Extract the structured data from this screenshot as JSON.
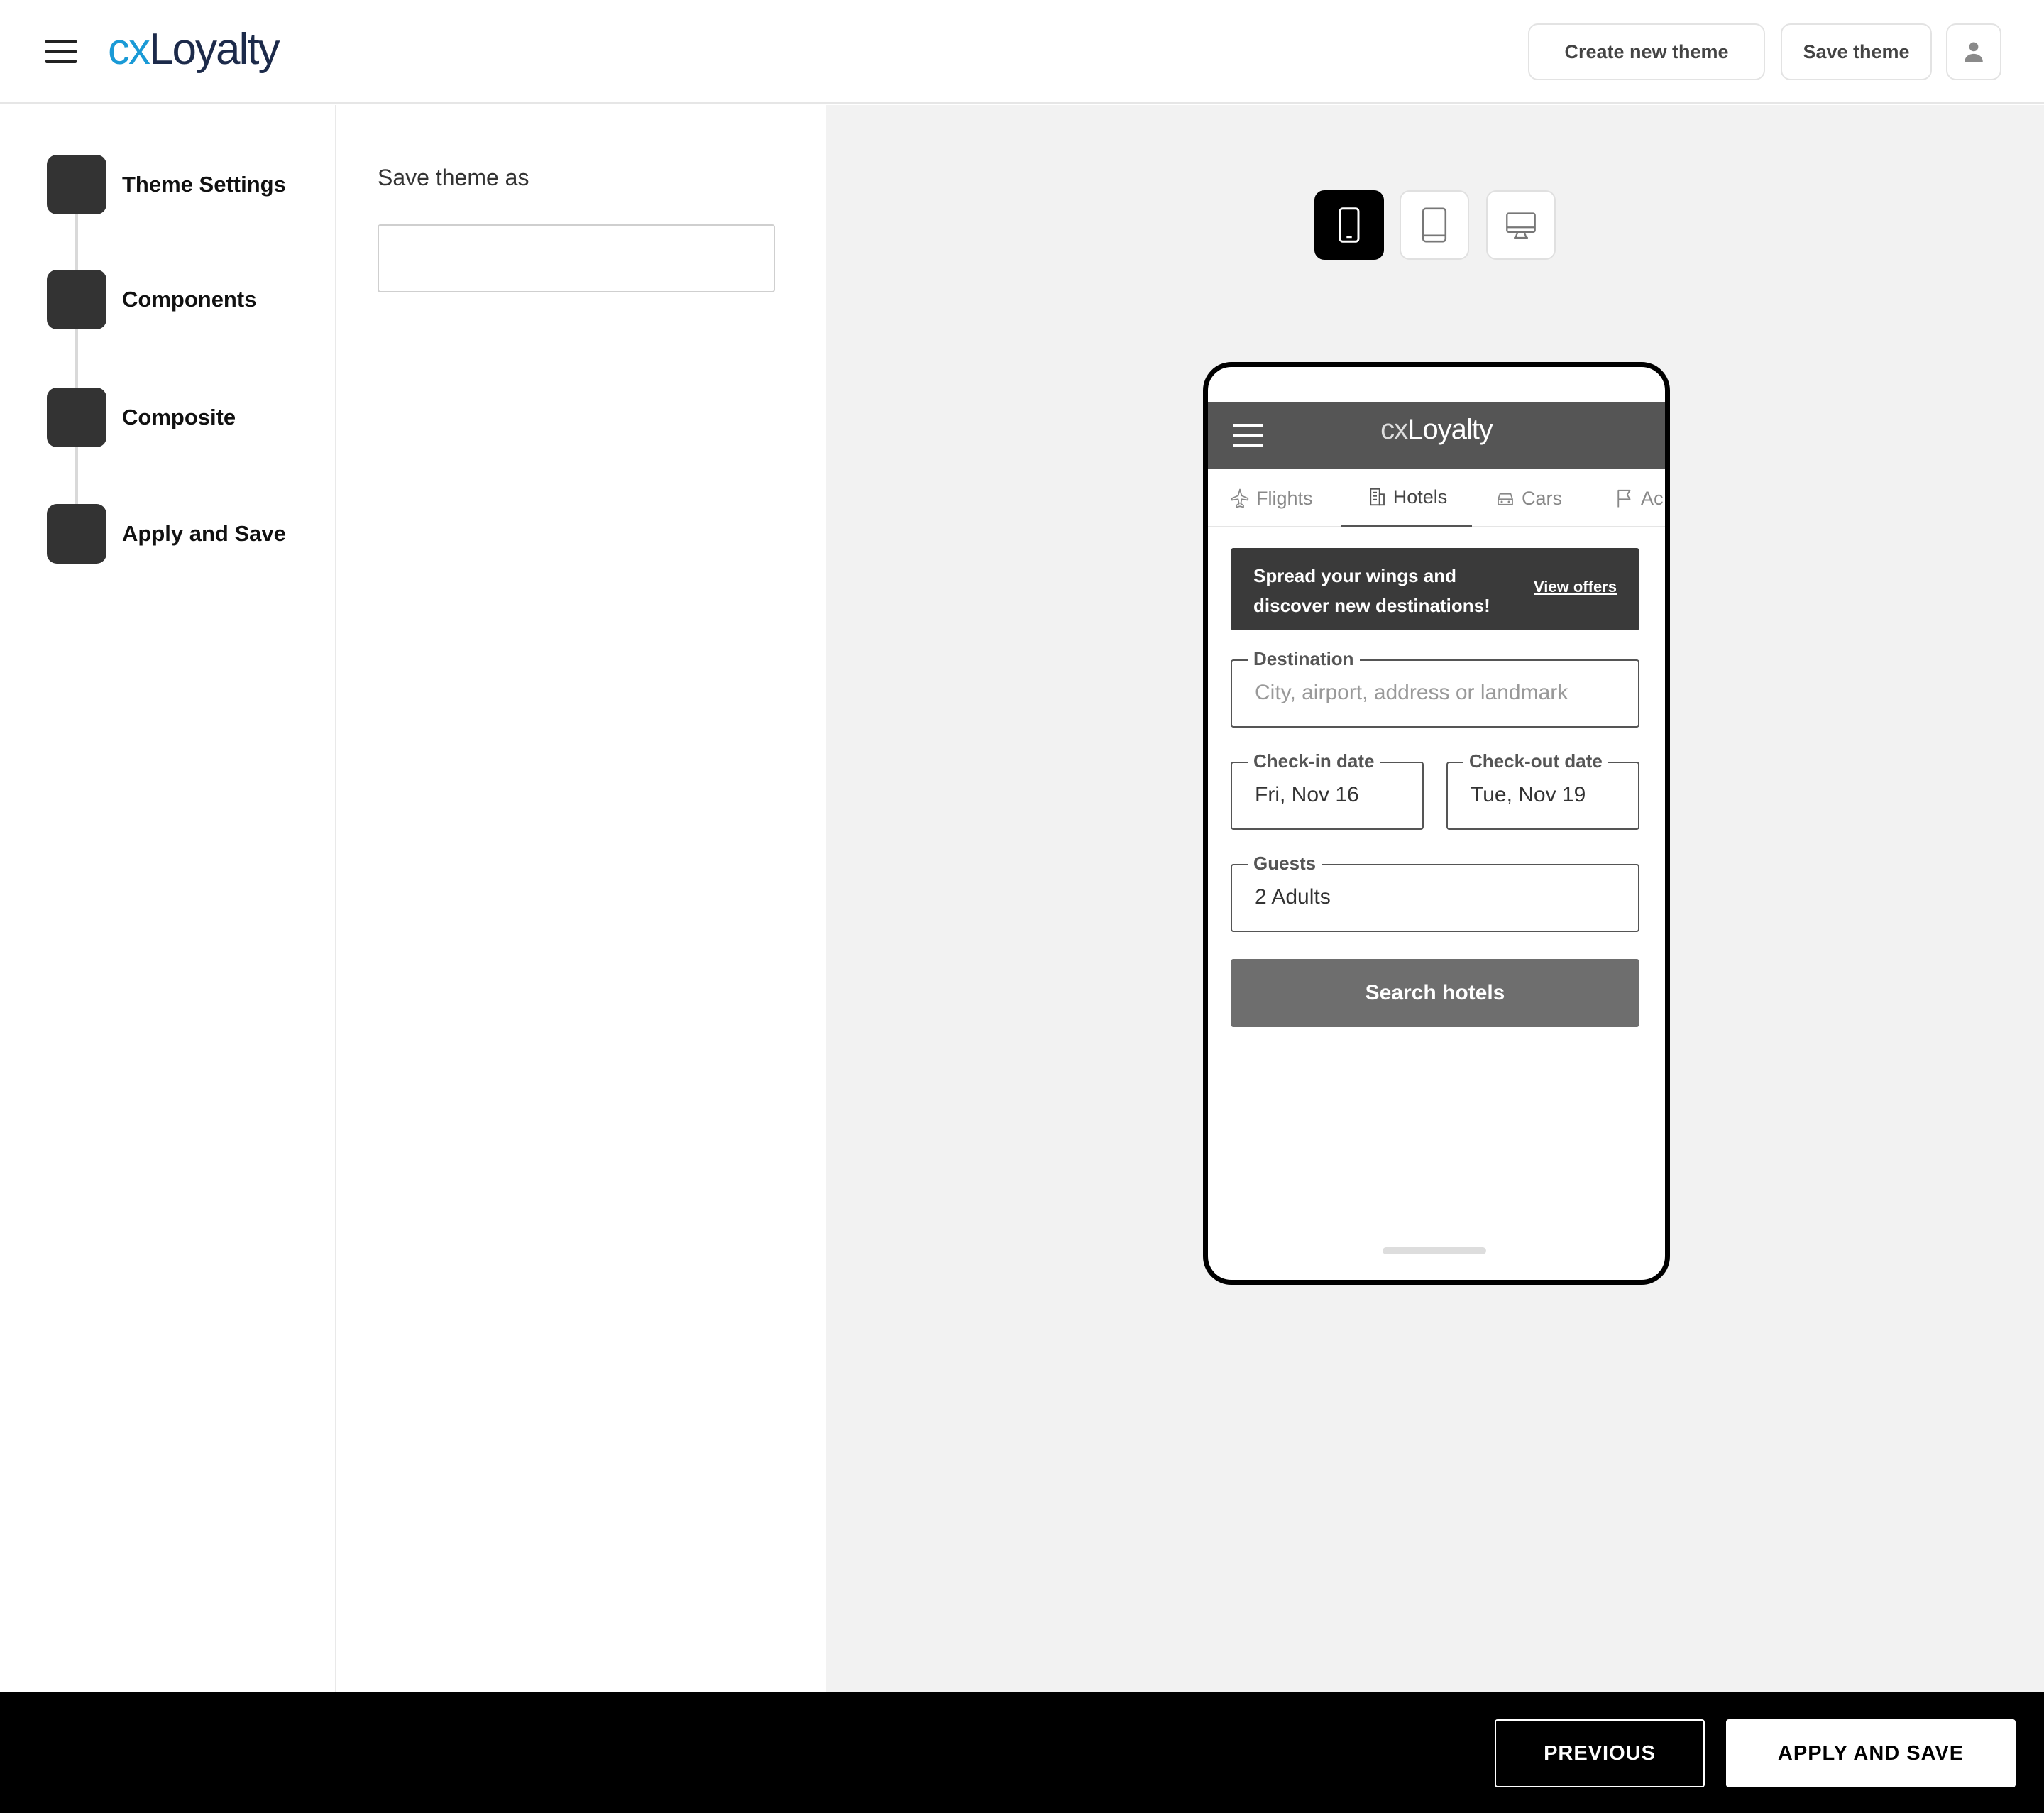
{
  "header": {
    "logo_cx": "cx",
    "logo_loyalty": "Loyalty",
    "create_theme_label": "Create new theme",
    "save_theme_label": "Save theme"
  },
  "stepper": {
    "steps": [
      {
        "label": "Theme Settings"
      },
      {
        "label": "Components"
      },
      {
        "label": "Composite"
      },
      {
        "label": "Apply and Save"
      }
    ]
  },
  "form": {
    "save_as_label": "Save theme as",
    "save_as_value": ""
  },
  "preview": {
    "devices": [
      "mobile-icon",
      "tablet-icon",
      "desktop-icon"
    ],
    "active_device": "mobile",
    "phone": {
      "logo_cx": "cx",
      "logo_loyalty": "Loyalty",
      "tabs": [
        {
          "label": "Flights",
          "icon": "plane-icon"
        },
        {
          "label": "Hotels",
          "icon": "building-icon",
          "active": true
        },
        {
          "label": "Cars",
          "icon": "car-icon"
        },
        {
          "label": "Ac",
          "icon": "flag-icon"
        }
      ],
      "banner": {
        "text": "Spread your wings and discover new destinations!",
        "link": "View offers"
      },
      "destination": {
        "label": "Destination",
        "placeholder": "City, airport, address or landmark"
      },
      "checkin": {
        "label": "Check-in date",
        "value": "Fri, Nov 16"
      },
      "checkout": {
        "label": "Check-out date",
        "value": "Tue, Nov 19"
      },
      "guests": {
        "label": "Guests",
        "value": "2 Adults"
      },
      "search_label": "Search hotels"
    }
  },
  "footer": {
    "previous_label": "PREVIOUS",
    "apply_label": "APPLY AND SAVE"
  },
  "colors": {
    "brand_blue": "#1a9ad6",
    "brand_navy": "#1c2a4a",
    "step_box": "#333333",
    "phone_header": "#555555"
  }
}
